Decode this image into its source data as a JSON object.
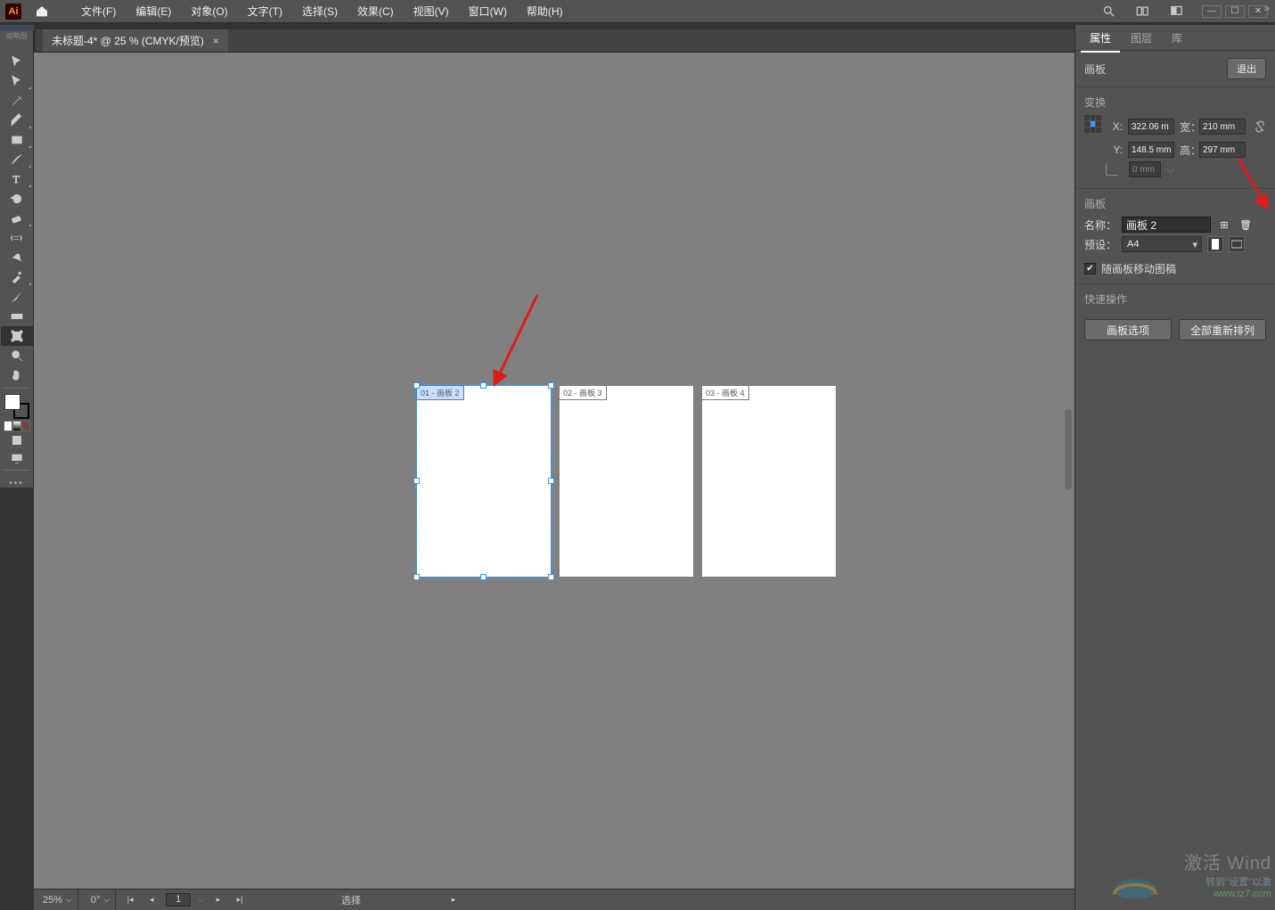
{
  "menubar": {
    "logo": "Ai",
    "items": [
      "文件(F)",
      "编辑(E)",
      "对象(O)",
      "文字(T)",
      "选择(S)",
      "效果(C)",
      "视图(V)",
      "窗口(W)",
      "帮助(H)"
    ]
  },
  "doc_tab": {
    "title": "未标题-4* @ 25 % (CMYK/预览)",
    "close": "×"
  },
  "left_strip": "缩略图",
  "artboards": [
    {
      "label": "01 - 画板 2",
      "selected": true
    },
    {
      "label": "02 - 画板 3",
      "selected": false
    },
    {
      "label": "03 - 画板 4",
      "selected": false
    }
  ],
  "rpanel": {
    "tabs": {
      "properties": "属性",
      "layers": "图层",
      "libraries": "库"
    },
    "exit": "退出",
    "section_artboard": "画板",
    "transform": {
      "title": "变换",
      "x_label": "X:",
      "x": "322.06 m",
      "y_label": "Y:",
      "y": "148.5 mm",
      "w_label": "宽：",
      "w": "210 mm",
      "h_label": "高：",
      "h": "297 mm",
      "angle": "0 mm"
    },
    "artboard_sec": {
      "title": "画板",
      "name_label": "名称：",
      "name": "画板 2",
      "preset_label": "预设：",
      "preset": "A4",
      "move_art": "随画板移动图稿"
    },
    "quick": {
      "title": "快速操作",
      "options": "画板选项",
      "rearrange": "全部重新排列"
    }
  },
  "statusbar": {
    "zoom": "25%",
    "angle": "0°",
    "page": "1",
    "tool": "选择"
  },
  "watermark": {
    "line1": "激活 Wind",
    "line2": "转到\"设置\"以激",
    "logo": "www.tz7.com"
  }
}
